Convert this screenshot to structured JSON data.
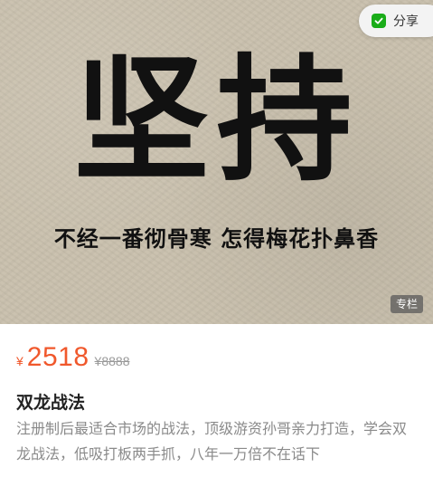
{
  "hero": {
    "title": "坚持",
    "subtitle": "不经一番彻骨寒 怎得梅花扑鼻香",
    "badge": "专栏"
  },
  "share": {
    "label": "分享",
    "icon": "share-icon",
    "icon_color": "#1aad19"
  },
  "price": {
    "currency": "¥",
    "amount": "2518",
    "original": "¥8888",
    "accent_color": "#f0582c"
  },
  "course": {
    "title": "双龙战法",
    "description": "注册制后最适合市场的战法，顶级游资孙哥亲力打造，学会双龙战法，低吸打板两手抓，八年一万倍不在话下"
  }
}
